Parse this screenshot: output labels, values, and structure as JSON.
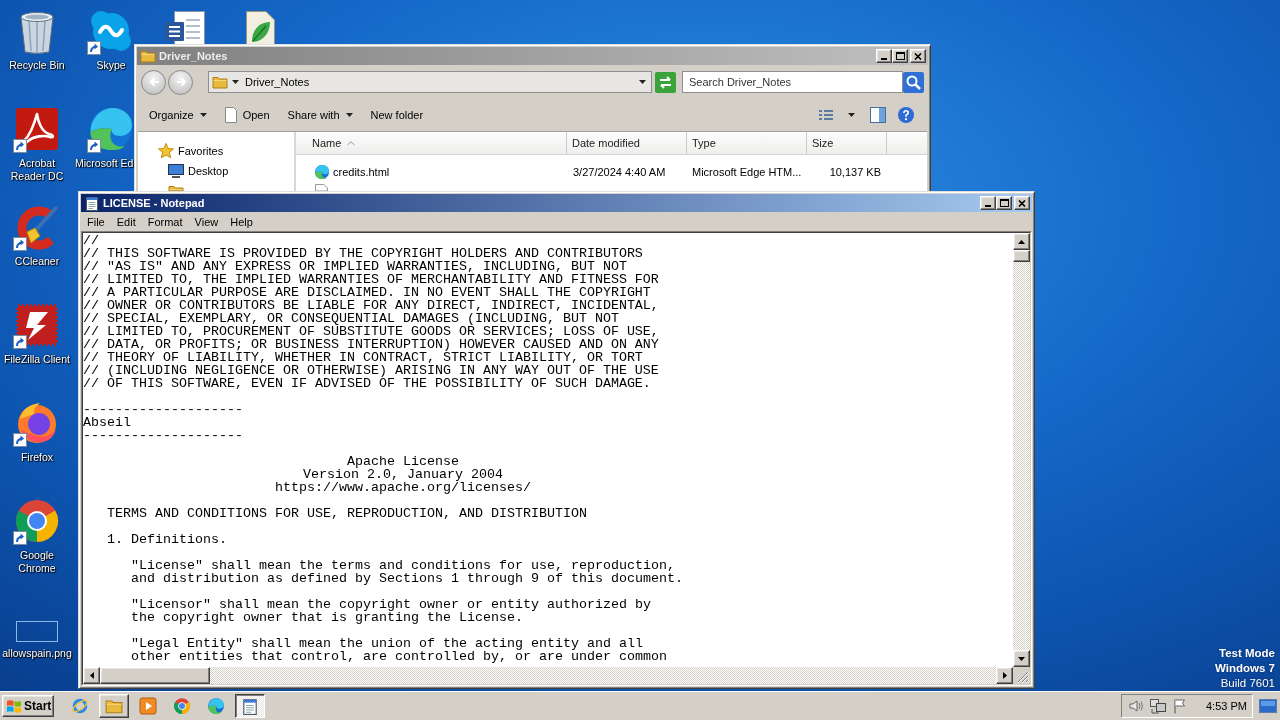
{
  "desktop": {
    "columns": [
      [
        {
          "label": "Recycle Bin",
          "shortcut": false
        },
        {
          "label": "Acrobat Reader DC",
          "shortcut": true
        },
        {
          "label": "CCleaner",
          "shortcut": true
        },
        {
          "label": "FileZilla Client",
          "shortcut": true
        },
        {
          "label": "Firefox",
          "shortcut": true
        },
        {
          "label": "Google Chrome",
          "shortcut": true
        },
        {
          "label": "allowspain.png",
          "shortcut": false
        }
      ],
      [
        {
          "label": "Skype",
          "shortcut": true
        },
        {
          "label": "Microsoft Ed",
          "shortcut": true
        }
      ]
    ],
    "os_notice": [
      {
        "text": "Test Mode",
        "kind": "emphasis"
      },
      {
        "text": "Windows 7",
        "kind": "emphasis"
      },
      {
        "text": "Build 7601",
        "kind": "plain"
      }
    ]
  },
  "explorer": {
    "title": "Driver_Notes",
    "active": false,
    "address": "Driver_Notes",
    "search": {
      "placeholder": "Search Driver_Notes"
    },
    "toolbar": [
      {
        "label": "Organize",
        "kind": "menu"
      },
      {
        "label": "Open",
        "kind": "open"
      },
      {
        "label": "Share with",
        "kind": "menu"
      },
      {
        "label": "New folder",
        "kind": "plain"
      }
    ],
    "nav": [
      {
        "label": "Favorites",
        "children": [
          {
            "label": "Desktop"
          }
        ]
      }
    ],
    "columns": [
      {
        "label": "Name",
        "sorted": true
      },
      {
        "label": "Date modified",
        "sorted": false
      },
      {
        "label": "Type",
        "sorted": false
      },
      {
        "label": "Size",
        "sorted": false
      }
    ],
    "rows": [
      {
        "cells": [
          "credits.html",
          "3/27/2024 4:40 AM",
          "Microsoft Edge HTM...",
          "10,137 KB"
        ]
      }
    ]
  },
  "notepad": {
    "title": "LICENSE - Notepad",
    "active": true,
    "menu": [
      "File",
      "Edit",
      "Format",
      "View",
      "Help"
    ],
    "blocks": [
      {
        "kind": "plain",
        "lines": [
          "//",
          "// THIS SOFTWARE IS PROVIDED BY THE COPYRIGHT HOLDERS AND CONTRIBUTORS",
          "// \"AS IS\" AND ANY EXPRESS OR IMPLIED WARRANTIES, INCLUDING, BUT NOT",
          "// LIMITED TO, THE IMPLIED WARRANTIES OF MERCHANTABILITY AND FITNESS FOR",
          "// A PARTICULAR PURPOSE ARE DISCLAIMED. IN NO EVENT SHALL THE COPYRIGHT",
          "// OWNER OR CONTRIBUTORS BE LIABLE FOR ANY DIRECT, INDIRECT, INCIDENTAL,",
          "// SPECIAL, EXEMPLARY, OR CONSEQUENTIAL DAMAGES (INCLUDING, BUT NOT",
          "// LIMITED TO, PROCUREMENT OF SUBSTITUTE GOODS OR SERVICES; LOSS OF USE,",
          "// DATA, OR PROFITS; OR BUSINESS INTERRUPTION) HOWEVER CAUSED AND ON ANY",
          "// THEORY OF LIABILITY, WHETHER IN CONTRACT, STRICT LIABILITY, OR TORT",
          "// (INCLUDING NEGLIGENCE OR OTHERWISE) ARISING IN ANY WAY OUT OF THE USE",
          "// OF THIS SOFTWARE, EVEN IF ADVISED OF THE POSSIBILITY OF SUCH DAMAGE."
        ]
      },
      {
        "kind": "plain",
        "lines": [
          "--------------------",
          "Abseil",
          "--------------------"
        ]
      },
      {
        "kind": "centered",
        "lines": [
          "Apache License",
          "Version 2.0, January 2004",
          "https://www.apache.org/licenses/"
        ]
      },
      {
        "kind": "section",
        "lines": [
          "TERMS AND CONDITIONS FOR USE, REPRODUCTION, AND DISTRIBUTION"
        ]
      },
      {
        "kind": "section",
        "lines": [
          "1. Definitions."
        ]
      },
      {
        "kind": "definition",
        "lines": [
          "\"License\" shall mean the terms and conditions for use, reproduction,",
          "and distribution as defined by Sections 1 through 9 of this document."
        ]
      },
      {
        "kind": "definition",
        "lines": [
          "\"Licensor\" shall mean the copyright owner or entity authorized by",
          "the copyright owner that is granting the License."
        ]
      },
      {
        "kind": "definition",
        "lines": [
          "\"Legal Entity\" shall mean the union of the acting entity and all",
          "other entities that control, are controlled by, or are under common"
        ]
      }
    ]
  },
  "taskbar": {
    "start": "Start",
    "apps": [
      {
        "open": false,
        "selected": false
      },
      {
        "open": true,
        "selected": false
      },
      {
        "open": false,
        "selected": false
      },
      {
        "open": false,
        "selected": false
      },
      {
        "open": false,
        "selected": false
      },
      {
        "open": true,
        "selected": true
      }
    ],
    "clock": "4:53 PM"
  }
}
